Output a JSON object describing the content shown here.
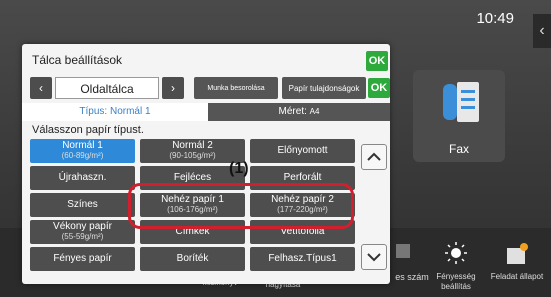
{
  "clock": "10:49",
  "side_arrow": "‹",
  "fax": {
    "label": "Fax"
  },
  "bottom_items": [
    {
      "label": "kézikönyv"
    },
    {
      "label": "nagyítása"
    },
    {
      "label": "es szám"
    },
    {
      "label": "Fényesség beállítás"
    },
    {
      "label": "Feladat állapot"
    }
  ],
  "dialog": {
    "title": "Tálca beállítások",
    "ok": "OK",
    "prev": "‹",
    "next": "›",
    "tray": "Oldaltálca",
    "job_class": "Munka besorolása",
    "paper_props": "Papír tulajdonságok",
    "tab_type": "Típus: Normál 1",
    "tab_size_label": "Méret:",
    "tab_size_value": "A4",
    "instruction": "Válasszon papír típust.",
    "paper_types": [
      {
        "label": "Normál 1",
        "sub": "(60-89g/m²)"
      },
      {
        "label": "Normál 2",
        "sub": "(90-105g/m²)"
      },
      {
        "label": "Előnyomott",
        "sub": ""
      },
      {
        "label": "Újrahaszn.",
        "sub": ""
      },
      {
        "label": "Fejléces",
        "sub": ""
      },
      {
        "label": "Perforált",
        "sub": ""
      },
      {
        "label": "Színes",
        "sub": ""
      },
      {
        "label": "Nehéz papír 1",
        "sub": "(106-176g/m²)"
      },
      {
        "label": "Nehéz papír 2",
        "sub": "(177-220g/m²)"
      },
      {
        "label": "Vékony papír",
        "sub": "(55-59g/m²)"
      },
      {
        "label": "Címkék",
        "sub": ""
      },
      {
        "label": "Vetítőfólia",
        "sub": ""
      },
      {
        "label": "Fényes papír",
        "sub": ""
      },
      {
        "label": "Boríték",
        "sub": ""
      },
      {
        "label": "Felhasz.Típus1",
        "sub": ""
      }
    ],
    "selected_index": 0
  },
  "callout": "(1)"
}
